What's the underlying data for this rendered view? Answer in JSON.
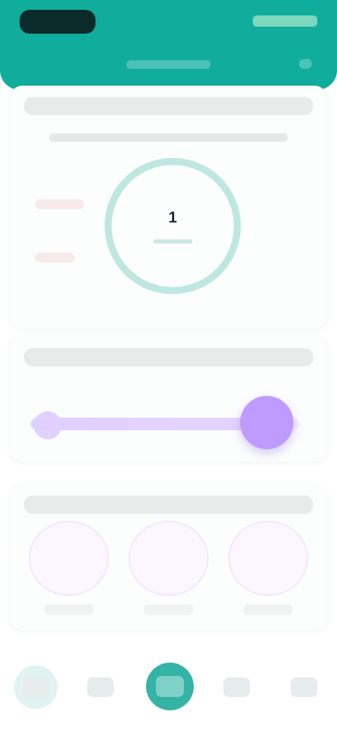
{
  "colors": {
    "primary": "#10ad9c",
    "ring": "#bfe7e1",
    "slider": "#be9bff"
  },
  "progress": {
    "center_text": "1",
    "ring_percent": 100
  },
  "slider": {
    "value_percent": 88
  },
  "tiles": [
    {
      "label": ""
    },
    {
      "label": ""
    },
    {
      "label": ""
    }
  ],
  "nav": {
    "items": [
      "",
      "",
      "",
      "",
      ""
    ]
  }
}
